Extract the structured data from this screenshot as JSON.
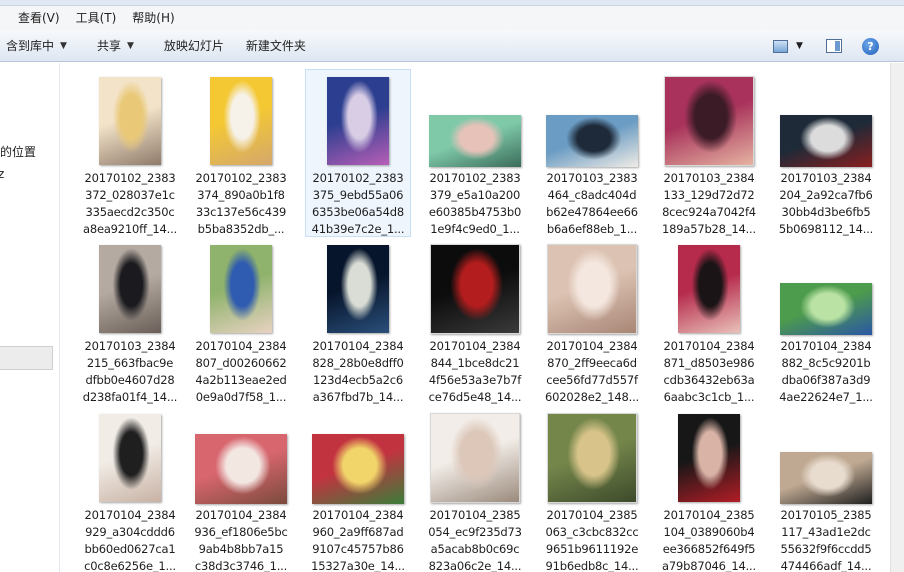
{
  "menubar": {
    "items": [
      "查看(V)",
      "工具(T)",
      "帮助(H)"
    ]
  },
  "toolbar": {
    "library_label": "含到库中",
    "share_label": "共享",
    "slideshow_label": "放映幻灯片",
    "new_folder_label": "新建文件夹"
  },
  "nav": {
    "location_text": "的位置",
    "fragment_text": "z"
  },
  "files": [
    {
      "lines": [
        "20170102_2383",
        "372_028037e1c",
        "335aecd2c350c",
        "a8ea9210ff_14..."
      ],
      "colors": [
        "#f3e3c9",
        "#e9c978",
        "#8f7a6a"
      ],
      "orient": "portrait"
    },
    {
      "lines": [
        "20170102_2383",
        "374_890a0b1f8",
        "33c137e56c439",
        "b5ba8352db_..."
      ],
      "colors": [
        "#f4c833",
        "#f6f2ea",
        "#d4a86b"
      ],
      "orient": "portrait"
    },
    {
      "lines": [
        "20170102_2383",
        "375_9ebd55a06",
        "6353be06a54d8",
        "41b39e7c2e_1..."
      ],
      "colors": [
        "#2c3e8f",
        "#d9cde6",
        "#b85fb7"
      ],
      "orient": "portrait",
      "selected": true
    },
    {
      "lines": [
        "20170102_2383",
        "379_e5a10a200",
        "e60385b4753b0",
        "1e9f4c9ed0_1..."
      ],
      "colors": [
        "#7fc9a9",
        "#e6c2b9",
        "#3a6c5a"
      ],
      "orient": "landscape"
    },
    {
      "lines": [
        "20170103_2383",
        "464_c8adc404d",
        "b62e47864ee66",
        "b6a6ef88eb_1..."
      ],
      "colors": [
        "#6b9cc3",
        "#1e2a3a",
        "#f0ece6"
      ],
      "orient": "landscape"
    },
    {
      "lines": [
        "20170103_2384",
        "133_129d72d72",
        "8cec924a7042f4",
        "189a57b28_14..."
      ],
      "colors": [
        "#a8325b",
        "#3a1b26",
        "#e5b3a1"
      ],
      "orient": "portrait-wide"
    },
    {
      "lines": [
        "20170103_2384",
        "204_2a92ca7fb6",
        "30bb4d3be6fb5",
        "5b0698112_14..."
      ],
      "colors": [
        "#1e2a38",
        "#dcdcdc",
        "#8a1f1f"
      ],
      "orient": "landscape"
    },
    {
      "lines": [
        "20170103_2384",
        "215_663fbac9e",
        "dfbb0e4607d28",
        "d238fa01f4_14..."
      ],
      "colors": [
        "#b5aaa1",
        "#1b1b1f",
        "#6a5f58"
      ],
      "orient": "portrait"
    },
    {
      "lines": [
        "20170104_2384",
        "807_d00260662",
        "4a2b113eae2ed",
        "0e9a0d7f58_1..."
      ],
      "colors": [
        "#8fb36c",
        "#2f5bb0",
        "#e8d2c2"
      ],
      "orient": "portrait"
    },
    {
      "lines": [
        "20170104_2384",
        "828_28b0e8dff0",
        "123d4ecb5a2c6",
        "a367fbd7b_14..."
      ],
      "colors": [
        "#07152c",
        "#d9ddd5",
        "#2a4f7a"
      ],
      "orient": "portrait"
    },
    {
      "lines": [
        "20170104_2384",
        "844_1bce8dc21",
        "4f56e53a3e7b7f",
        "ce76d5e48_14..."
      ],
      "colors": [
        "#0c0c0c",
        "#b31d1d",
        "#3a3a3a"
      ],
      "orient": "portrait-wide"
    },
    {
      "lines": [
        "20170104_2384",
        "870_2ff9eeca6d",
        "cee56fd77d557f",
        "602028e2_148..."
      ],
      "colors": [
        "#dcc2b2",
        "#f4e7df",
        "#a88676"
      ],
      "orient": "portrait-wide"
    },
    {
      "lines": [
        "20170104_2384",
        "871_d8503e986",
        "cdb36432eb63a",
        "6aabc3c1cb_1..."
      ],
      "colors": [
        "#b62b4c",
        "#1a1416",
        "#e9c2ba"
      ],
      "orient": "portrait"
    },
    {
      "lines": [
        "20170104_2384",
        "882_8c5c9201b",
        "dba06f387a3d9",
        "4ae22624e7_1..."
      ],
      "colors": [
        "#4d9b4c",
        "#b9e2a4",
        "#2b57a5"
      ],
      "orient": "landscape"
    },
    {
      "lines": [
        "20170104_2384",
        "929_a304cddd6",
        "bb60ed0627ca1",
        "c0c8e6256e_1..."
      ],
      "colors": [
        "#f1ece6",
        "#1f1f1f",
        "#c8b2a4"
      ],
      "orient": "portrait"
    },
    {
      "lines": [
        "20170104_2384",
        "936_ef1806e5bc",
        "9ab4b8bb7a15",
        "c38d3c3746_1..."
      ],
      "colors": [
        "#d8666f",
        "#f3e7e2",
        "#7a4a3c"
      ],
      "orient": "landscape-tall"
    },
    {
      "lines": [
        "20170104_2384",
        "960_2a9ff687ad",
        "9107c45757b86",
        "15327a30e_14..."
      ],
      "colors": [
        "#c23340",
        "#f1d56a",
        "#3b7d3a"
      ],
      "orient": "landscape-tall"
    },
    {
      "lines": [
        "20170104_2385",
        "054_ec9f235d73",
        "a5acab8b0c69c",
        "823a06c2e_14..."
      ],
      "colors": [
        "#f2ede8",
        "#dcc7b9",
        "#9b8a7c"
      ],
      "orient": "portrait-wide"
    },
    {
      "lines": [
        "20170104_2385",
        "063_c3cbc832cc",
        "9651b9611192e",
        "91b6edb8c_14..."
      ],
      "colors": [
        "#75864b",
        "#d8c48a",
        "#3d4a2b"
      ],
      "orient": "portrait-wide"
    },
    {
      "lines": [
        "20170104_2385",
        "104_0389060b4",
        "ee366852f649f5",
        "a79b87046_14..."
      ],
      "colors": [
        "#171717",
        "#d9b3a6",
        "#b31d26"
      ],
      "orient": "portrait"
    },
    {
      "lines": [
        "20170105_2385",
        "117_43ad1e2dc",
        "55632f9f6ccdd5",
        "474466adf_14..."
      ],
      "colors": [
        "#bfa992",
        "#e8dccf",
        "#1f1f1f"
      ],
      "orient": "landscape"
    }
  ]
}
